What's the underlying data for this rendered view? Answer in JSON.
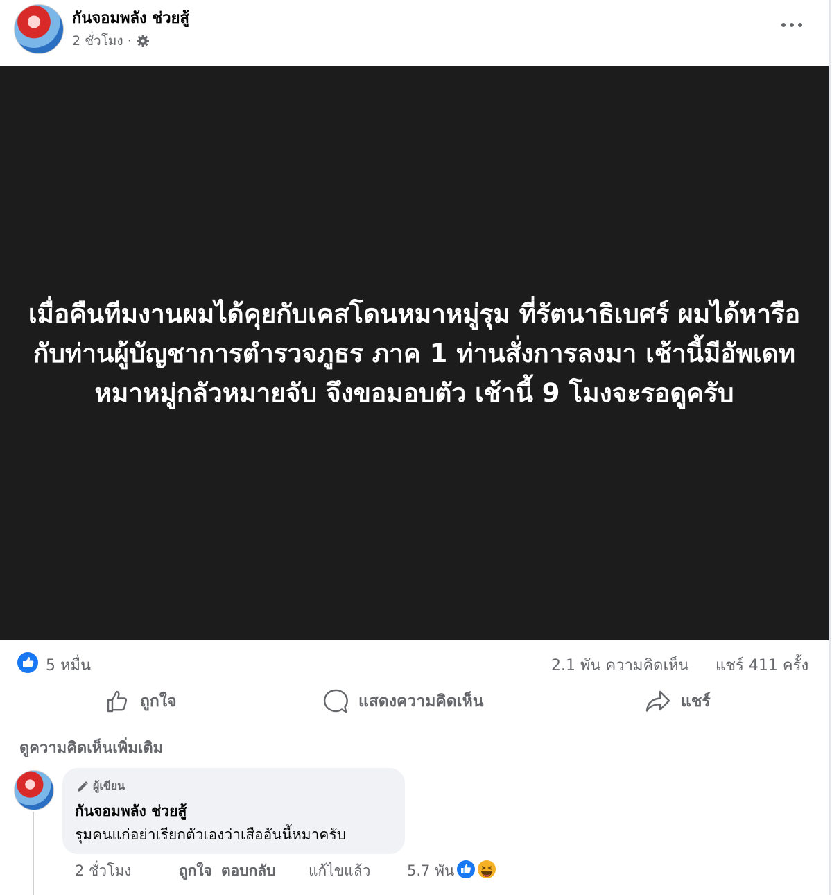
{
  "post": {
    "page_name": "กันจอมพลัง ช่วยสู้",
    "time": "2 ชั่วโมง ·",
    "image_text": "เมื่อคืนทีมงานผมได้คุยกับเคสโดนหมาหมู่รุม ที่รัตนาธิเบศร์ ผมได้หารือกับท่านผู้บัญชาการตำรวจภูธร ภาค 1 ท่านสั่งการลงมา เช้านี้มีอัพเดท หมาหมู่กลัวหมายจับ จึงขอมอบตัว เช้านี้ 9 โมงจะรอดูครับ",
    "icons": {
      "privacy": "gear-icon",
      "more": "more-dots-icon"
    }
  },
  "stats": {
    "reactions": "5 หมื่น",
    "comments": "2.1 พัน ความคิดเห็น",
    "shares": "แชร์ 411 ครั้ง"
  },
  "actions": {
    "like": "ถูกใจ",
    "comment": "แสดงความคิดเห็น",
    "share": "แชร์"
  },
  "more_comments": "ดูความคิดเห็นเพิ่มเติม",
  "comment": {
    "badge": "ผู้เขียน",
    "author": "กันจอมพลัง ช่วยสู้",
    "text": "รุมคนแก่อย่าเรียกตัวเองว่าเสืออันนี้หมาครับ",
    "time": "2 ชั่วโมง",
    "like": "ถูกใจ",
    "reply": "ตอบกลับ",
    "edited": "แก้ไขแล้ว",
    "reaction_count": "5.7 พัน"
  },
  "colors": {
    "like_blue": "#1877f2",
    "secondary_text": "#65676b",
    "bubble": "#f0f2f5",
    "image_bg": "#1c1c1c"
  }
}
